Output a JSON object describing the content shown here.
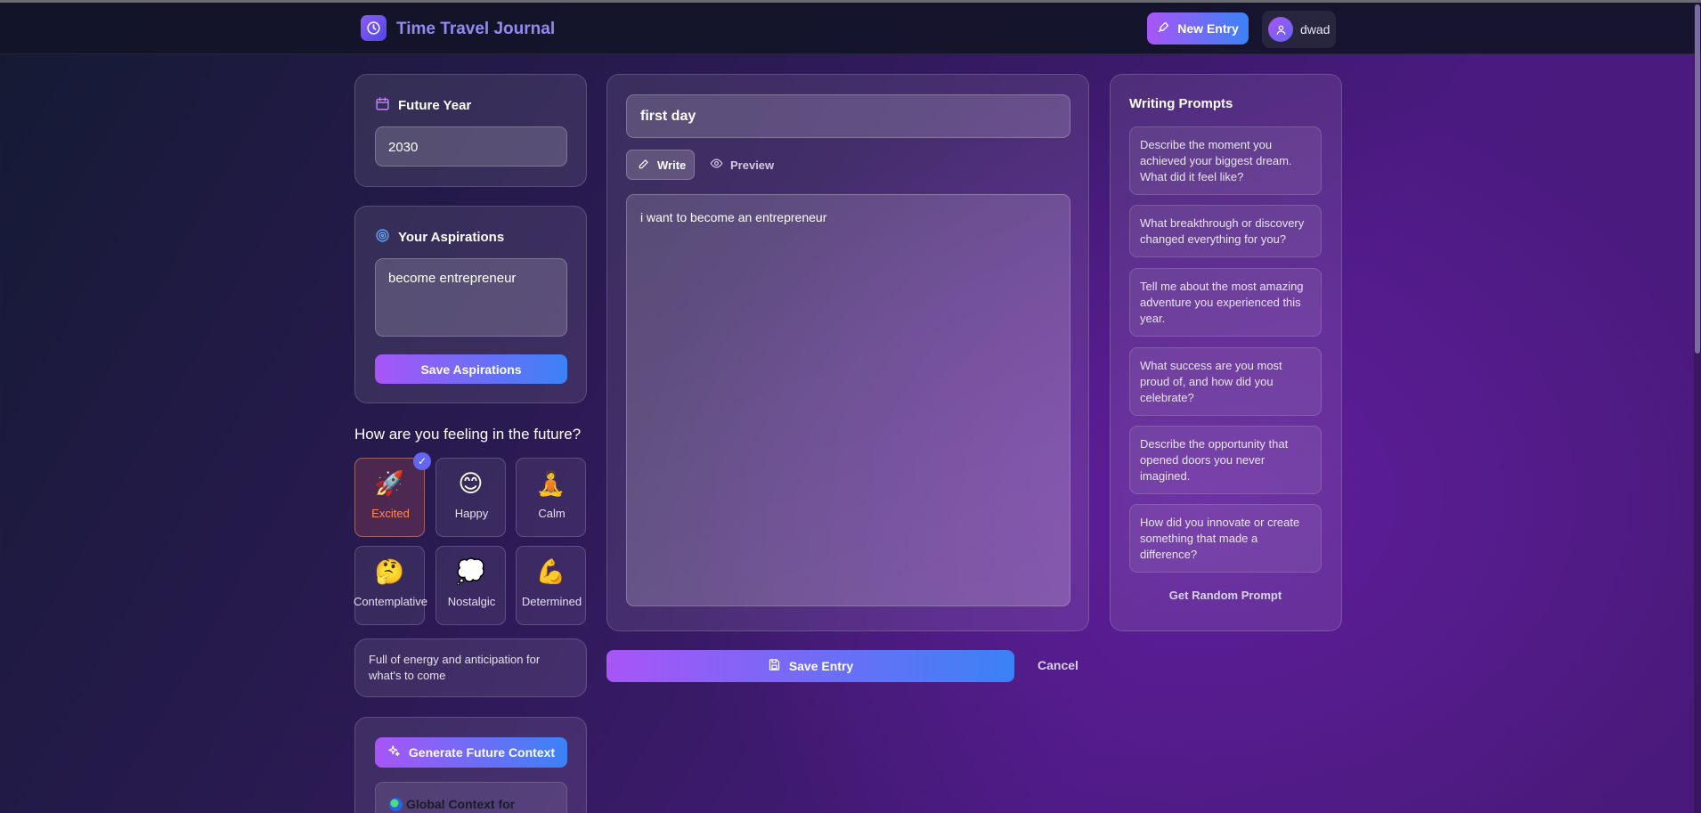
{
  "app": {
    "title": "Time Travel Journal"
  },
  "header": {
    "new_entry_label": "New Entry",
    "username": "dwad"
  },
  "future_year": {
    "title": "Future Year",
    "value": "2030"
  },
  "aspirations": {
    "title": "Your Aspirations",
    "value": "become entrepreneur",
    "save_label": "Save Aspirations"
  },
  "mood": {
    "question": "How are you feeling in the future?",
    "options": [
      {
        "emoji": "🚀",
        "label": "Excited",
        "selected": true
      },
      {
        "emoji": "😊",
        "label": "Happy",
        "selected": false
      },
      {
        "emoji": "🧘",
        "label": "Calm",
        "selected": false
      },
      {
        "emoji": "🤔",
        "label": "Contemplative",
        "selected": false
      },
      {
        "emoji": "💭",
        "label": "Nostalgic",
        "selected": false
      },
      {
        "emoji": "💪",
        "label": "Determined",
        "selected": false
      }
    ],
    "description": "Full of energy and anticipation for what's to come",
    "check_glyph": "✓"
  },
  "context": {
    "generate_label": "Generate Future Context",
    "global_title": "Global Context for"
  },
  "editor": {
    "title_value": "first day",
    "tabs": {
      "write": "Write",
      "preview": "Preview"
    },
    "body_value": "i want to become an entrepreneur",
    "save_label": "Save Entry",
    "cancel_label": "Cancel"
  },
  "prompts": {
    "title": "Writing Prompts",
    "items": [
      "Describe the moment you achieved your biggest dream. What did it feel like?",
      "What breakthrough or discovery changed everything for you?",
      "Tell me about the most amazing adventure you experienced this year.",
      "What success are you most proud of, and how did you celebrate?",
      "Describe the opportunity that opened doors you never imagined.",
      "How did you innovate or create something that made a difference?"
    ],
    "random_label": "Get Random Prompt"
  },
  "colors": {
    "accent_purple": "#a855f7",
    "accent_blue": "#3b82f6",
    "selected_mood_text": "#ff8a5c"
  }
}
